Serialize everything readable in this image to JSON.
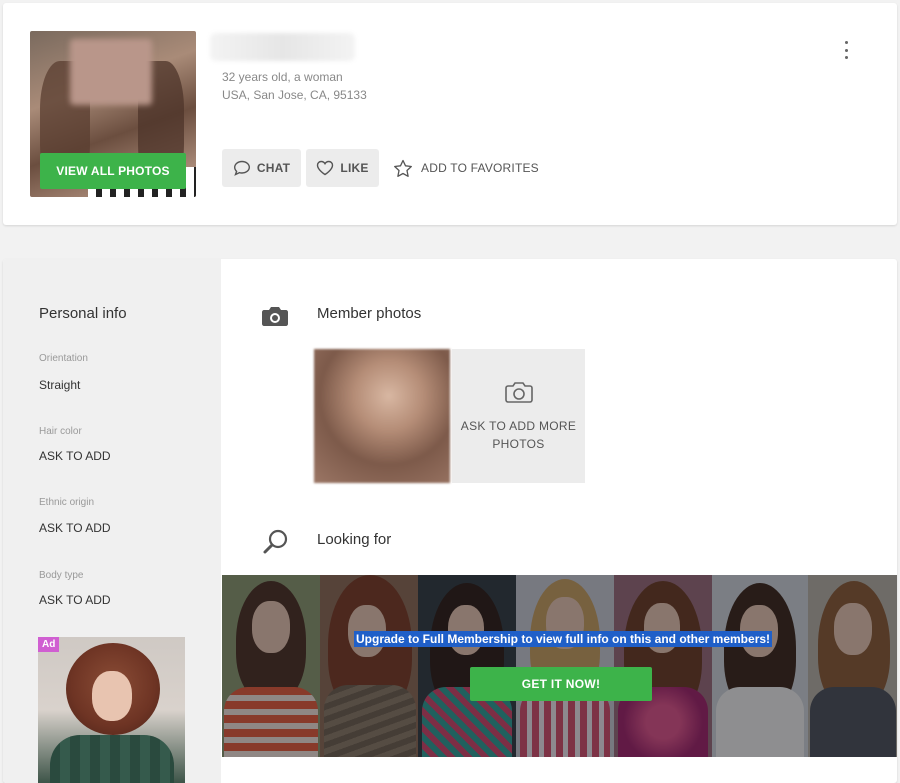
{
  "profile": {
    "age_gender": "32 years old, a woman",
    "location": "USA, San Jose, CA, 95133",
    "view_all_photos_label": "VIEW ALL PHOTOS",
    "actions": {
      "chat_label": "CHAT",
      "like_label": "LIKE",
      "favorites_label": "ADD TO FAVORITES"
    }
  },
  "personal_info": {
    "title": "Personal info",
    "fields": [
      {
        "label": "Orientation",
        "value": "Straight"
      },
      {
        "label": "Hair color",
        "value": "ASK TO ADD"
      },
      {
        "label": "Ethnic origin",
        "value": "ASK TO ADD"
      },
      {
        "label": "Body type",
        "value": "ASK TO ADD"
      }
    ],
    "ad_badge": "Ad"
  },
  "member_photos": {
    "title": "Member photos",
    "ask_more_label": "ASK TO ADD MORE PHOTOS"
  },
  "looking_for": {
    "title": "Looking for",
    "upgrade_text": "Upgrade to Full Membership to view full info on this and other members!",
    "cta_label": "GET IT NOW!"
  },
  "colors": {
    "accent_green": "#3db34a",
    "ad_badge": "#d05fd1",
    "selection_blue": "#1f5fc8"
  },
  "icons": [
    "more-vertical-icon",
    "chat-bubble-icon",
    "heart-icon",
    "star-icon",
    "camera-icon",
    "search-icon"
  ]
}
